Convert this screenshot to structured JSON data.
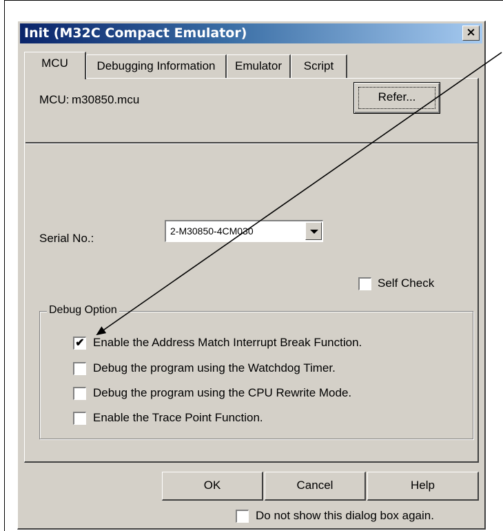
{
  "dialog": {
    "title": "Init (M32C Compact Emulator)",
    "close_label": "×"
  },
  "tabs": [
    {
      "label": "MCU",
      "active": true
    },
    {
      "label": "Debugging Information",
      "active": false
    },
    {
      "label": "Emulator",
      "active": false
    },
    {
      "label": "Script",
      "active": false
    }
  ],
  "mcu": {
    "label": "MCU:",
    "value": "m30850.mcu",
    "refer_label": "Refer..."
  },
  "serial": {
    "label": "Serial No.:",
    "selected": "2-M30850-4CM030"
  },
  "self_check": {
    "label": "Self Check",
    "checked": false
  },
  "debug_option": {
    "title": "Debug Option",
    "items": [
      {
        "label": "Enable the Address Match Interrupt Break Function.",
        "checked": true,
        "mark": "✔"
      },
      {
        "label": "Debug the program using the Watchdog Timer.",
        "checked": false,
        "mark": ""
      },
      {
        "label": "Debug the program using the CPU Rewrite Mode.",
        "checked": false,
        "mark": ""
      },
      {
        "label": "Enable the Trace Point Function.",
        "checked": false,
        "mark": ""
      }
    ]
  },
  "buttons": {
    "ok": "OK",
    "cancel": "Cancel",
    "help": "Help"
  },
  "dont_show": {
    "label": "Do not show this dialog box again.",
    "checked": false
  }
}
